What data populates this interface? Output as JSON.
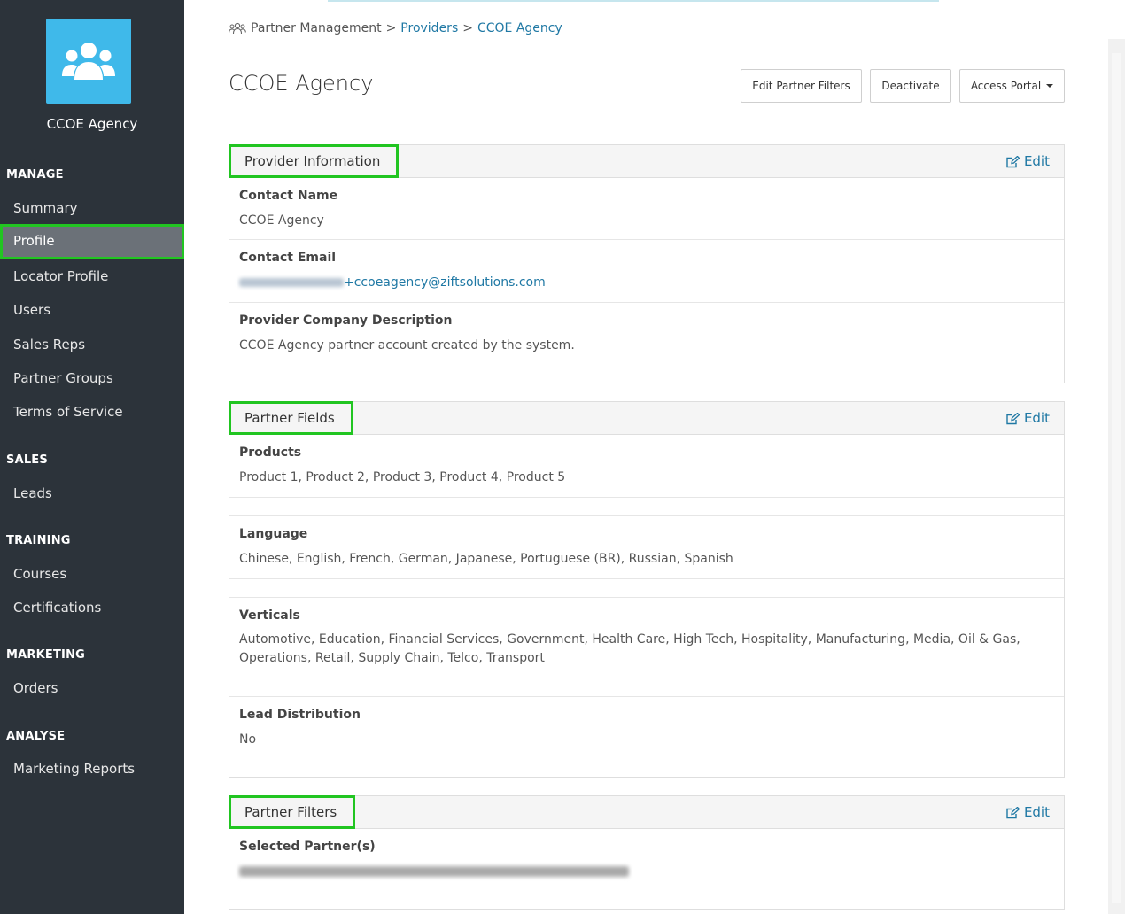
{
  "sidebar": {
    "org_name": "CCOE Agency",
    "sections": {
      "manage": "MANAGE",
      "sales": "SALES",
      "training": "TRAINING",
      "marketing": "MARKETING",
      "analyse": "ANALYSE"
    },
    "items": {
      "summary": "Summary",
      "profile": "Profile",
      "locator_profile": "Locator Profile",
      "users": "Users",
      "sales_reps": "Sales Reps",
      "partner_groups": "Partner Groups",
      "terms_of_service": "Terms of Service",
      "leads": "Leads",
      "courses": "Courses",
      "certifications": "Certifications",
      "orders": "Orders",
      "marketing_reports": "Marketing Reports"
    },
    "active_item": "Profile",
    "logo_icon": "users-group-icon"
  },
  "breadcrumb": {
    "root": "Partner Management",
    "sep": ">",
    "providers": "Providers",
    "current": "CCOE Agency",
    "icon": "users-outline-icon"
  },
  "page": {
    "title": "CCOE Agency"
  },
  "actions": {
    "edit_partner_filters": "Edit Partner Filters",
    "deactivate": "Deactivate",
    "access_portal": "Access Portal"
  },
  "provider_info": {
    "title": "Provider Information",
    "edit": "Edit",
    "contact_name_label": "Contact Name",
    "contact_name": "CCOE Agency",
    "contact_email_label": "Contact Email",
    "contact_email_suffix": "+ccoeagency@ziftsolutions.com",
    "description_label": "Provider Company Description",
    "description": "CCOE Agency partner account created by the system."
  },
  "partner_fields": {
    "title": "Partner Fields",
    "edit": "Edit",
    "products_label": "Products",
    "products": "Product 1, Product 2, Product 3, Product 4, Product 5",
    "language_label": "Language",
    "language": "Chinese, English, French, German, Japanese, Portuguese (BR), Russian, Spanish",
    "verticals_label": "Verticals",
    "verticals_line1": "Automotive, Education, Financial Services, Government, Health Care, High Tech, Hospitality, Manufacturing, Media, Oil & Gas,",
    "verticals_line2": "Operations, Retail, Supply Chain, Telco, Transport",
    "lead_distribution_label": "Lead Distribution",
    "lead_distribution": "No"
  },
  "partner_filters": {
    "title": "Partner Filters",
    "edit": "Edit",
    "selected_label": "Selected Partner(s)"
  },
  "colors": {
    "sidebar_bg": "#2c333a",
    "active_item_bg": "#6b7178",
    "highlight_green": "#21c521",
    "link_blue": "#1f78a4",
    "logo_bg": "#3fb9ea"
  }
}
